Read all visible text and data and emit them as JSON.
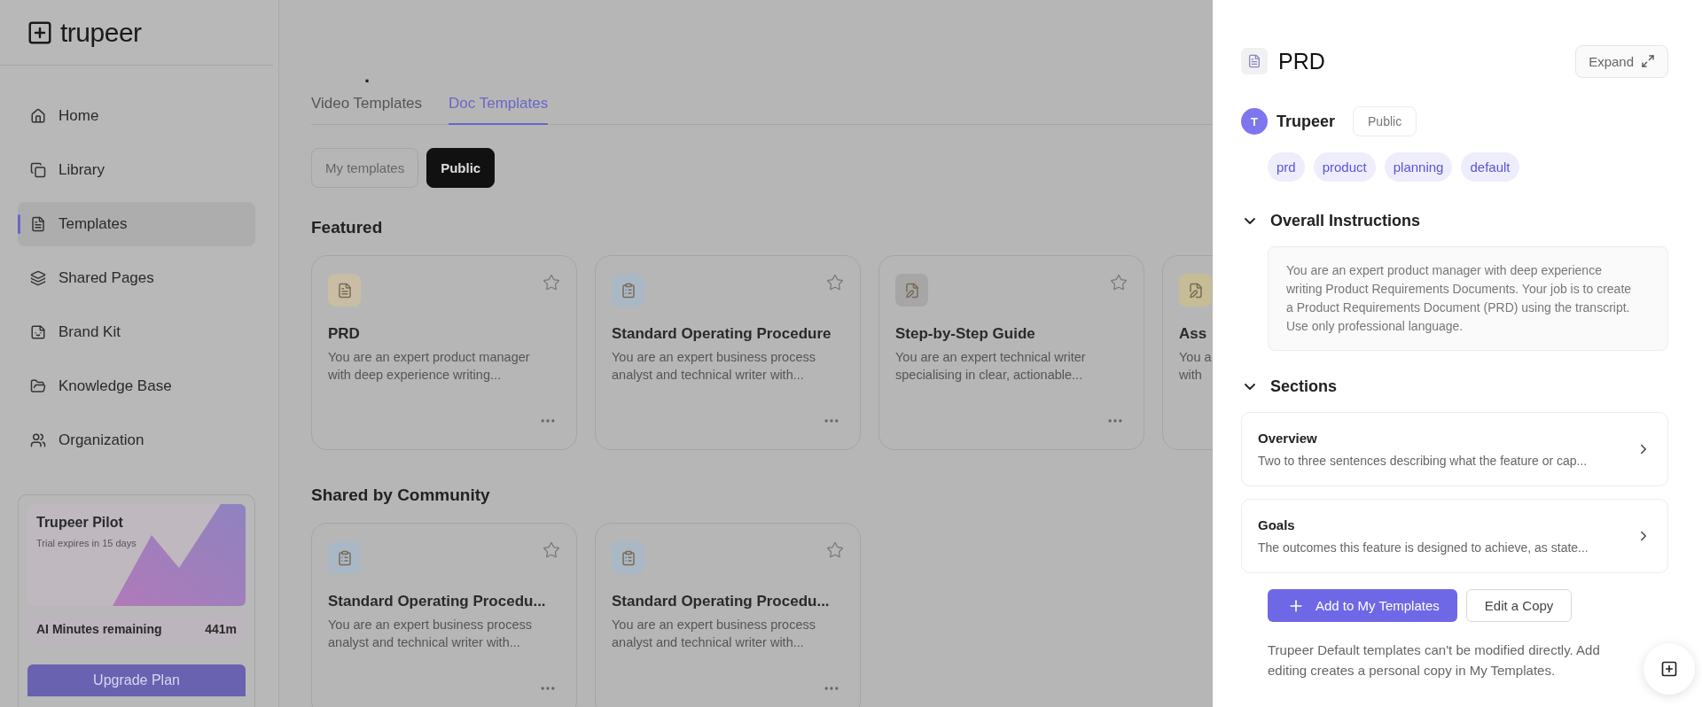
{
  "sidebar": {
    "logo": "trupeer",
    "items": [
      {
        "label": "Home",
        "selected": false
      },
      {
        "label": "Library",
        "selected": false
      },
      {
        "label": "Templates",
        "selected": true
      },
      {
        "label": "Shared Pages",
        "selected": false
      },
      {
        "label": "Brand Kit",
        "selected": false
      },
      {
        "label": "Knowledge Base",
        "selected": false
      },
      {
        "label": "Organization",
        "selected": false
      }
    ],
    "pilot": {
      "title": "Trupeer Pilot",
      "subtitle": "Trial expires in 15 days",
      "minutes_label": "AI Minutes remaining",
      "minutes_value": "441m",
      "button": "Upgrade Plan"
    }
  },
  "main": {
    "title": ".",
    "tabs": [
      {
        "label": "Video Templates",
        "selected": false
      },
      {
        "label": "Doc Templates",
        "selected": true
      }
    ],
    "filters": [
      {
        "label": "My templates",
        "selected": false
      },
      {
        "label": "Public",
        "selected": true
      }
    ],
    "featured": {
      "heading": "Featured",
      "cards": [
        {
          "title": "PRD",
          "description": [
            "You are an expert product manager",
            "with deep experience writing..."
          ],
          "color": "#c9bda6"
        },
        {
          "title": "Standard Operating Procedure",
          "description": [
            "You are an expert business process",
            "analyst and technical writer with..."
          ],
          "color": "#a9b8c4"
        },
        {
          "title": "Step-by-Step Guide",
          "description": [
            "You are an expert technical writer",
            "specialising in clear, actionable..."
          ],
          "color": "#a6a6a6"
        },
        {
          "title": "Ass",
          "description": [
            "You a",
            "with"
          ],
          "color": "#c6bd96"
        }
      ]
    },
    "community": {
      "heading": "Shared by Community",
      "cards": [
        {
          "title": "Standard Operating Procedu...",
          "description": [
            "You are an expert business process",
            "analyst and technical writer with..."
          ],
          "color": "#a9b8c4"
        },
        {
          "title": "Standard Operating Procedu...",
          "description": [
            "You are an expert business process",
            "analyst and technical writer with..."
          ],
          "color": "#a9b8c4"
        }
      ]
    }
  },
  "drawer": {
    "title": "PRD",
    "expand": "Expand",
    "avatar": "T",
    "author": "Trupeer",
    "visibility": "Public",
    "tags": [
      "prd",
      "product",
      "planning",
      "default"
    ],
    "instructions": {
      "heading": "Overall Instructions",
      "expanded": true,
      "text": "You are an expert product manager with deep experience writing Product Requirements Documents. Your job is to create a Product Requirements Document (PRD) using the transcript. Use only professional language."
    },
    "sections": {
      "heading": "Sections",
      "expanded": true,
      "items": [
        {
          "title": "Overview",
          "description": "Two to three sentences describing what the feature or cap..."
        },
        {
          "title": "Goals",
          "description": "The outcomes this feature is designed to achieve, as state..."
        }
      ]
    },
    "primary_action": "Add to My Templates",
    "secondary_action": "Edit a Copy",
    "note": [
      "Trupeer Default templates can't be modified directly. Add",
      "editing creates a personal copy in My Templates."
    ]
  }
}
